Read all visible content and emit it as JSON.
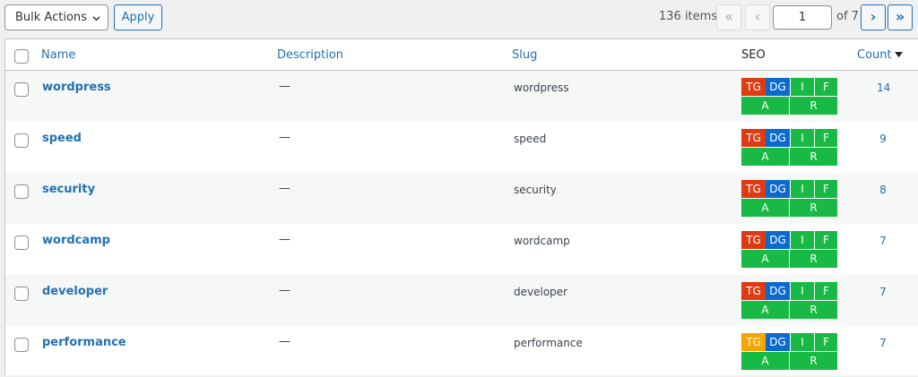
{
  "colors": {
    "accent": "#2271b1",
    "seo_red": "#dd3b13",
    "seo_orange": "#f6a500",
    "seo_blue": "#0c6acd",
    "seo_green": "#18b944"
  },
  "toolbar": {
    "bulk_actions_label": "Bulk Actions",
    "bulk_icon": "chevron-down-icon",
    "apply_label": "Apply"
  },
  "pagination": {
    "item_count": "136 items",
    "first_label": "«",
    "prev_label": "‹",
    "current_page": "1",
    "of_label": "of 7",
    "next_label": "›",
    "last_label": "»"
  },
  "table": {
    "columns": {
      "name": "Name",
      "description": "Description",
      "slug": "Slug",
      "seo": "SEO",
      "count": "Count"
    },
    "sort_icon": "sort-descending-icon",
    "seo_badge_labels": {
      "tg": "TG",
      "dg": "DG",
      "i": "I",
      "f": "F",
      "a": "A",
      "r": "R"
    },
    "rows": [
      {
        "name": "wordpress",
        "description": "—",
        "slug": "wordpress",
        "count": "14",
        "tg_status": "red"
      },
      {
        "name": "speed",
        "description": "—",
        "slug": "speed",
        "count": "9",
        "tg_status": "red"
      },
      {
        "name": "security",
        "description": "—",
        "slug": "security",
        "count": "8",
        "tg_status": "red"
      },
      {
        "name": "wordcamp",
        "description": "—",
        "slug": "wordcamp",
        "count": "7",
        "tg_status": "red"
      },
      {
        "name": "developer",
        "description": "—",
        "slug": "developer",
        "count": "7",
        "tg_status": "red"
      },
      {
        "name": "performance",
        "description": "—",
        "slug": "performance",
        "count": "7",
        "tg_status": "orange"
      }
    ]
  }
}
